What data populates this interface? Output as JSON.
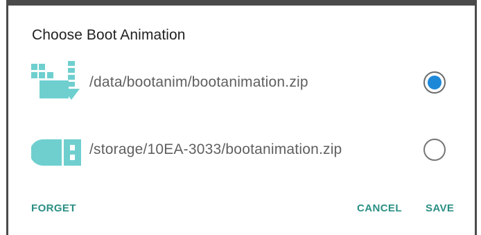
{
  "dialog": {
    "title": "Choose Boot Animation",
    "accent_color": "#1e88d8",
    "icon_color": "#6fcfcf",
    "button_color": "#2a8f84",
    "options": [
      {
        "label": "/data/bootanim/bootanimation.zip",
        "icon": "download-file-icon",
        "selected": true
      },
      {
        "label": "/storage/10EA-3033/bootanimation.zip",
        "icon": "usb-drive-icon",
        "selected": false
      }
    ],
    "actions": {
      "forget": "FORGET",
      "cancel": "CANCEL",
      "save": "SAVE"
    }
  }
}
